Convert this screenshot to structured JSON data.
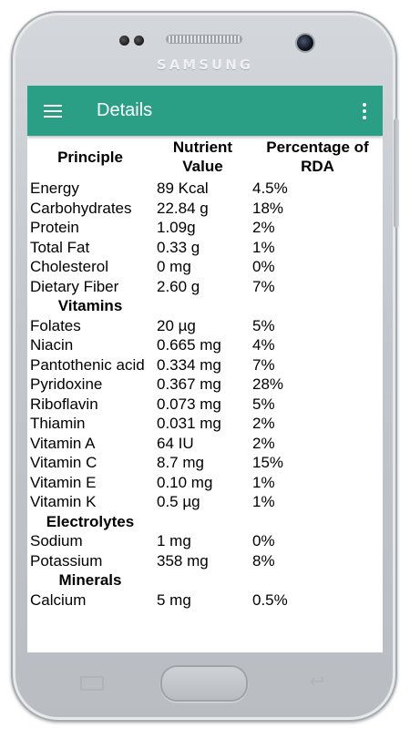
{
  "device": {
    "brand": "SAMSUNG"
  },
  "appbar": {
    "title": "Details",
    "menu_icon": "hamburger-menu-icon",
    "overflow_icon": "more-vert-icon"
  },
  "table": {
    "headers": {
      "principle": "Principle",
      "nutrient_value": "Nutrient Value",
      "percentage": "Percentage of RDA"
    },
    "rows": [
      {
        "name": "Energy",
        "value": "89 Kcal",
        "pct": "4.5%"
      },
      {
        "name": "Carbohydrates",
        "value": "22.84 g",
        "pct": "18%"
      },
      {
        "name": "Protein",
        "value": "1.09g",
        "pct": "2%"
      },
      {
        "name": "Total Fat",
        "value": "0.33 g",
        "pct": "1%"
      },
      {
        "name": "Cholesterol",
        "value": "0 mg",
        "pct": "0%"
      },
      {
        "name": "Dietary Fiber",
        "value": "2.60 g",
        "pct": "7%"
      },
      {
        "section": "Vitamins"
      },
      {
        "name": "Folates",
        "value": "20 µg",
        "pct": "5%"
      },
      {
        "name": "Niacin",
        "value": "0.665 mg",
        "pct": "4%"
      },
      {
        "name": "Pantothenic acid",
        "value": "0.334 mg",
        "pct": "7%"
      },
      {
        "name": "Pyridoxine",
        "value": "0.367 mg",
        "pct": "28%"
      },
      {
        "name": "Riboflavin",
        "value": "0.073 mg",
        "pct": "5%"
      },
      {
        "name": "Thiamin",
        "value": "0.031 mg",
        "pct": "2%"
      },
      {
        "name": "Vitamin A",
        "value": "64 IU",
        "pct": "2%"
      },
      {
        "name": "Vitamin C",
        "value": "8.7 mg",
        "pct": "15%"
      },
      {
        "name": "Vitamin E",
        "value": "0.10 mg",
        "pct": "1%"
      },
      {
        "name": "Vitamin K",
        "value": "0.5 µg",
        "pct": "1%"
      },
      {
        "section": "Electrolytes"
      },
      {
        "name": "Sodium",
        "value": "1 mg",
        "pct": "0%"
      },
      {
        "name": "Potassium",
        "value": "358 mg",
        "pct": "8%"
      },
      {
        "section": "Minerals"
      },
      {
        "name": "Calcium",
        "value": "5 mg",
        "pct": "0.5%"
      }
    ]
  },
  "colors": {
    "appbar": "#2a9f86",
    "phone_body": "#c3c7cc"
  }
}
